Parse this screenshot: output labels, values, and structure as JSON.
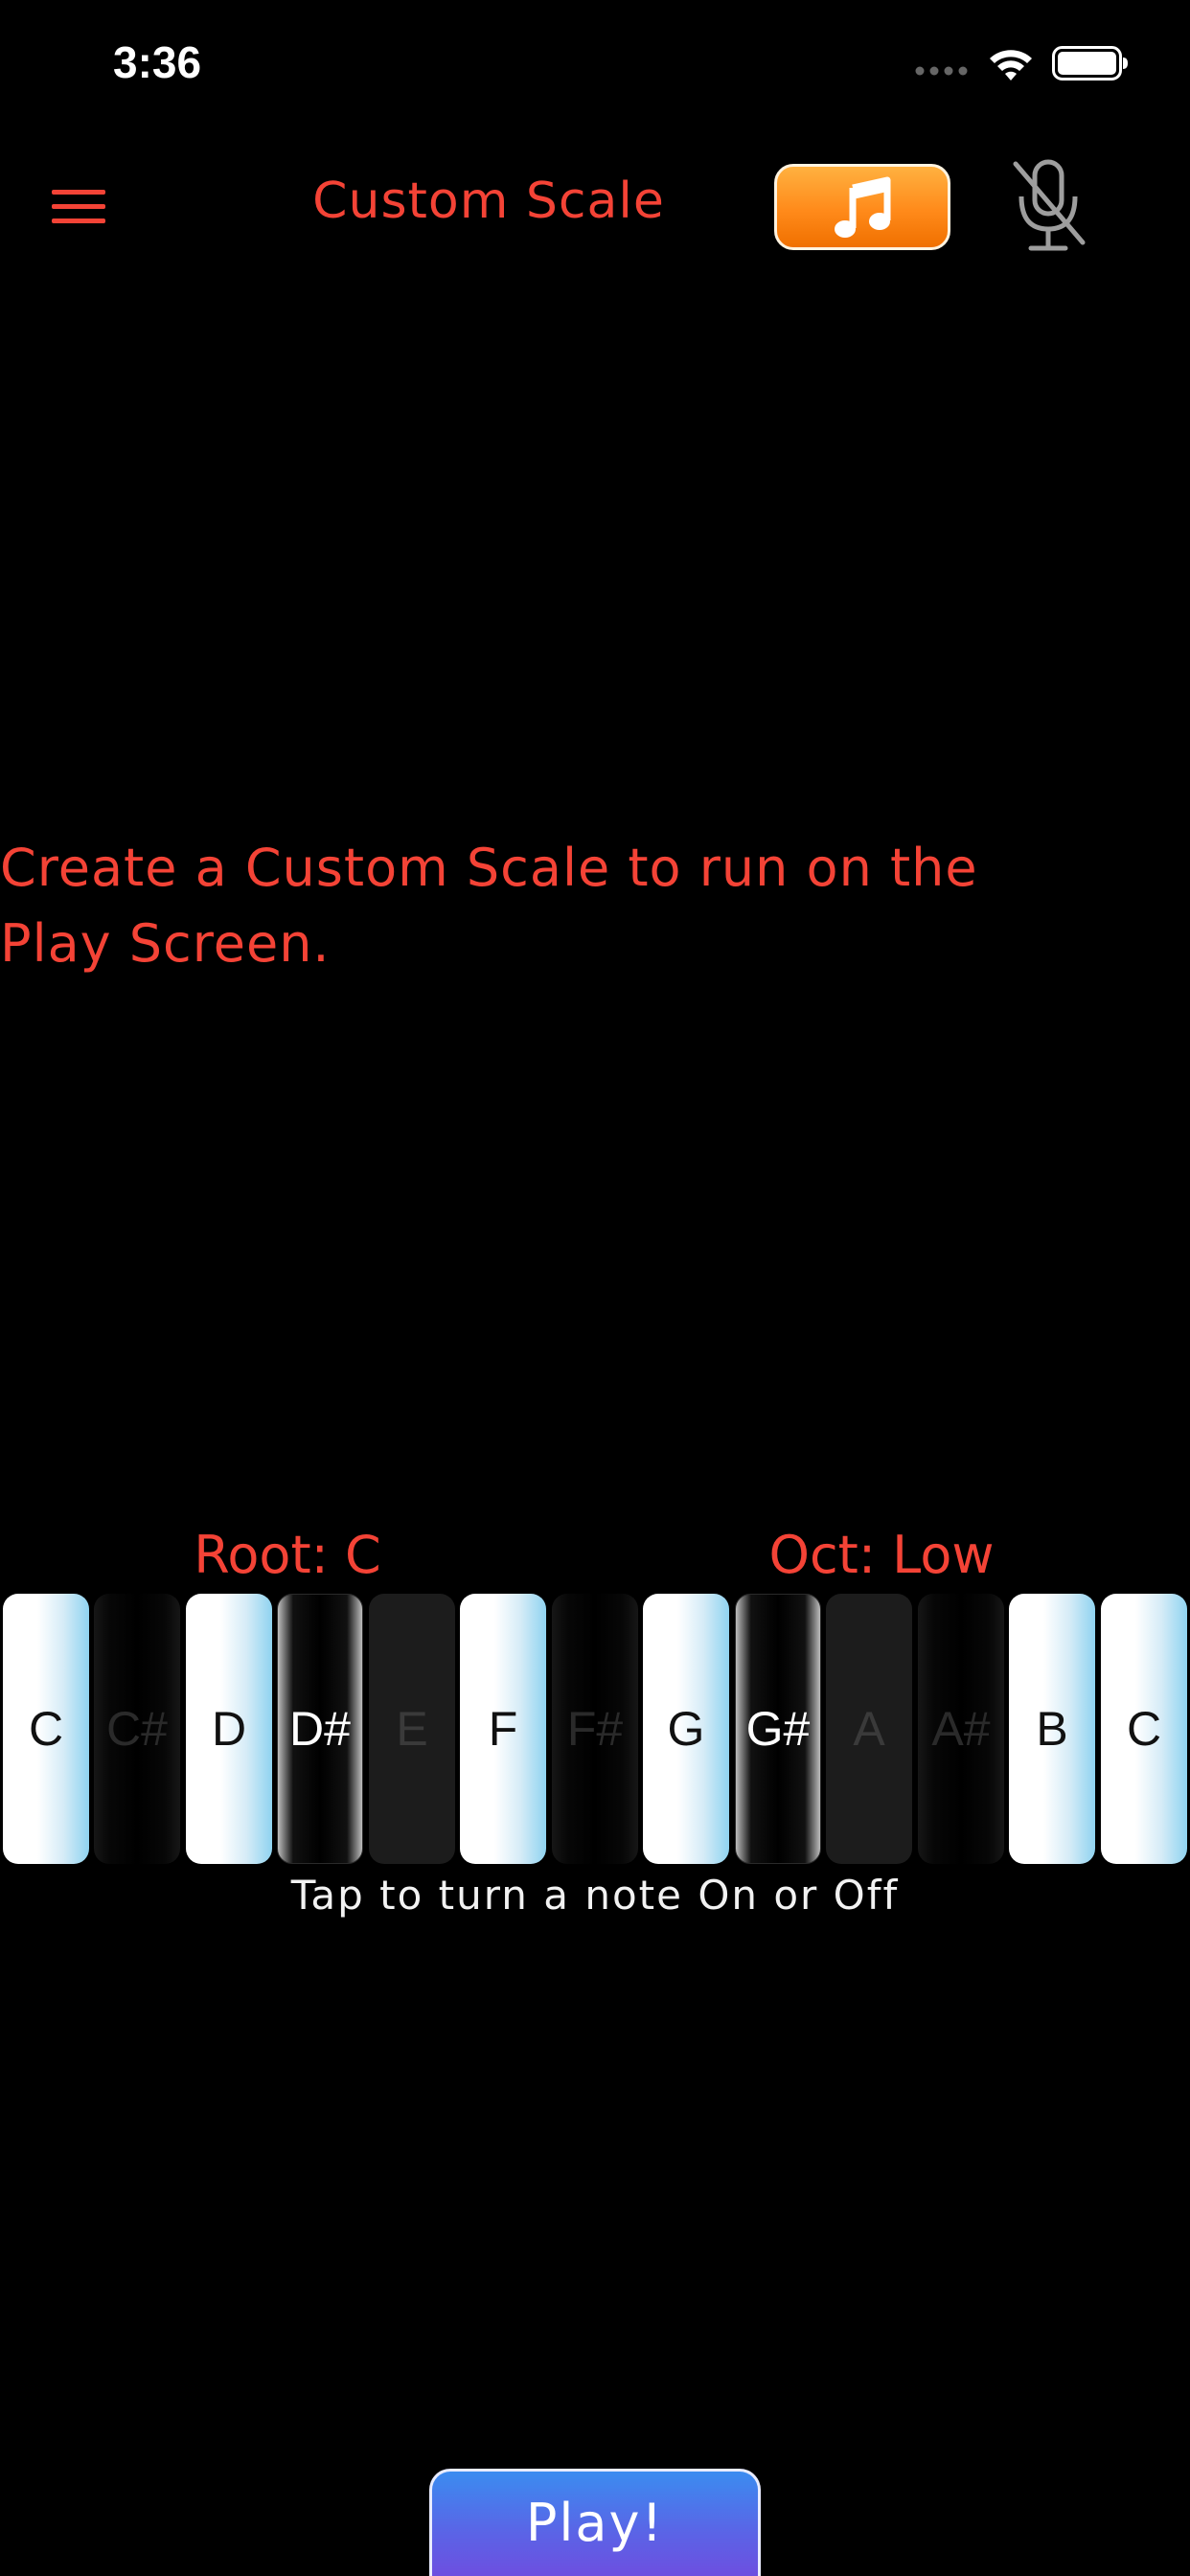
{
  "status_bar": {
    "time": "3:36",
    "icons": [
      "signal-icon",
      "wifi-icon",
      "battery-icon"
    ]
  },
  "header": {
    "title": "Custom Scale",
    "menu_icon": "hamburger-menu-icon",
    "note_button_icon": "music-note-icon",
    "mic_icon": "microphone-off-icon"
  },
  "description": {
    "line1": "Create a Custom Scale to run on the",
    "line2": "Play Screen."
  },
  "controls": {
    "root": "Root: C",
    "octave": "Oct: Low"
  },
  "keys": [
    {
      "label": "C",
      "on": true
    },
    {
      "label": "C#",
      "on": false
    },
    {
      "label": "D",
      "on": true
    },
    {
      "label": "D#",
      "on": true
    },
    {
      "label": "E",
      "on": false
    },
    {
      "label": "F",
      "on": true
    },
    {
      "label": "F#",
      "on": false
    },
    {
      "label": "G",
      "on": true
    },
    {
      "label": "G#",
      "on": true
    },
    {
      "label": "A",
      "on": false
    },
    {
      "label": "A#",
      "on": false
    },
    {
      "label": "B",
      "on": true
    },
    {
      "label": "C",
      "on": true
    }
  ],
  "hint": "Tap to turn a note On or Off",
  "play_button": "Play!",
  "colors": {
    "accent_red": "#f44336",
    "note_button_orange": "#ff8a1a",
    "play_button_blue": "#4a78ec"
  }
}
